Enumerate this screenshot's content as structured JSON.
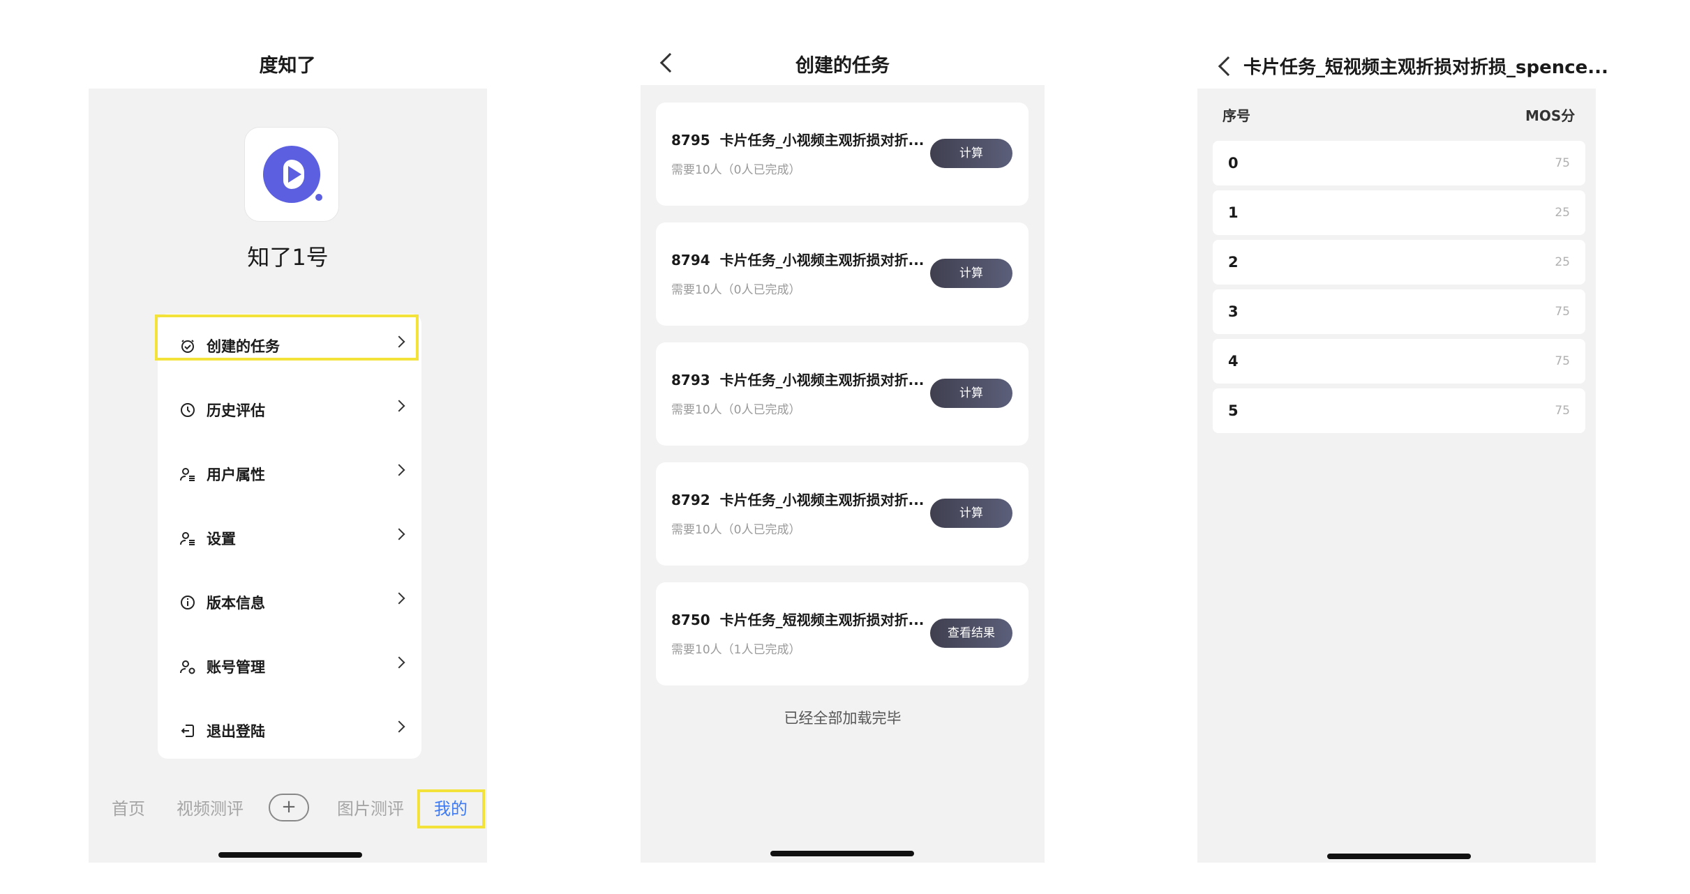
{
  "screen1": {
    "title": "度知了",
    "app_name": "知了1号",
    "menu": [
      {
        "label": "创建的任务",
        "icon": "task-clock-icon"
      },
      {
        "label": "历史评估",
        "icon": "history-clock-icon"
      },
      {
        "label": "用户属性",
        "icon": "user-list-icon"
      },
      {
        "label": "设置",
        "icon": "user-list-icon"
      },
      {
        "label": "版本信息",
        "icon": "info-icon"
      },
      {
        "label": "账号管理",
        "icon": "user-settings-icon"
      },
      {
        "label": "退出登陆",
        "icon": "logout-icon"
      }
    ],
    "tabs": {
      "home": "首页",
      "video_eval": "视频测评",
      "plus": "+",
      "image_eval": "图片测评",
      "mine": "我的"
    },
    "highlight_color": "#f3e23a",
    "active_tab_color": "#3d7bf5"
  },
  "screen2": {
    "title": "创建的任务",
    "tasks": [
      {
        "id": "8795",
        "name": "卡片任务_小视频主观折损对折...",
        "sub": "需要10人（0人已完成）",
        "button": "计算"
      },
      {
        "id": "8794",
        "name": "卡片任务_小视频主观折损对折...",
        "sub": "需要10人（0人已完成）",
        "button": "计算"
      },
      {
        "id": "8793",
        "name": "卡片任务_小视频主观折损对折...",
        "sub": "需要10人（0人已完成）",
        "button": "计算"
      },
      {
        "id": "8792",
        "name": "卡片任务_小视频主观折损对折...",
        "sub": "需要10人（0人已完成）",
        "button": "计算"
      },
      {
        "id": "8750",
        "name": "卡片任务_短视频主观折损对折...",
        "sub": "需要10人（1人已完成）",
        "button": "查看结果"
      }
    ],
    "footer": "已经全部加载完毕"
  },
  "screen3": {
    "title": "卡片任务_短视频主观折损对折损_spence...",
    "col_index": "序号",
    "col_score": "MOS分",
    "rows": [
      {
        "index": "0",
        "score": "75"
      },
      {
        "index": "1",
        "score": "25"
      },
      {
        "index": "2",
        "score": "25"
      },
      {
        "index": "3",
        "score": "75"
      },
      {
        "index": "4",
        "score": "75"
      },
      {
        "index": "5",
        "score": "75"
      }
    ]
  }
}
